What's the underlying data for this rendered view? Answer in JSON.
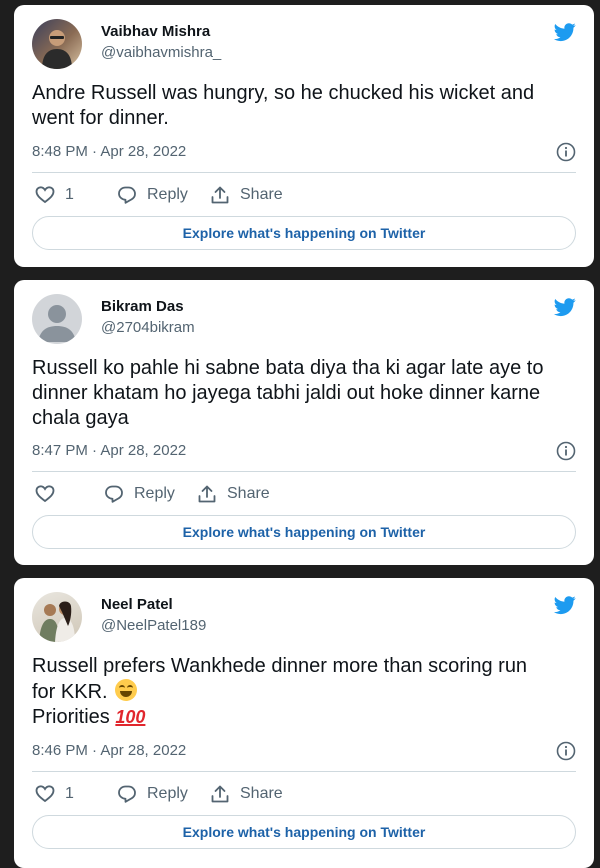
{
  "explore_label": "Explore what's happening on Twitter",
  "colors": {
    "twitter_blue": "#1d9bf0",
    "link_blue": "#1d62a8",
    "text": "#0f1419",
    "secondary": "#536471"
  },
  "tweets": [
    {
      "name": "Vaibhav Mishra",
      "handle": "@vaibhavmishra_",
      "lines": [
        "Andre Russell was hungry, so he chucked his wicket and",
        "went for dinner."
      ],
      "time": "8:48 PM · Apr 28, 2022",
      "likes": "1",
      "reply_label": "Reply",
      "share_label": "Share"
    },
    {
      "name": "Bikram Das",
      "handle": "@2704bikram",
      "lines": [
        "Russell ko pahle hi sabne bata diya tha ki agar late aye to",
        "dinner khatam ho jayega tabhi jaldi out hoke dinner karne",
        "chala gaya"
      ],
      "time": "8:47 PM · Apr 28, 2022",
      "likes": "",
      "reply_label": "Reply",
      "share_label": "Share"
    },
    {
      "name": "Neel Patel",
      "handle": "@NeelPatel189",
      "lines": [
        "Russell prefers Wankhede dinner more than scoring run",
        "for KKR.",
        "Priorities"
      ],
      "emojis": [
        "face-with-tears-of-joy",
        "hundred-points"
      ],
      "emoji_100": "100",
      "time": "8:46 PM · Apr 28, 2022",
      "likes": "1",
      "reply_label": "Reply",
      "share_label": "Share"
    }
  ]
}
